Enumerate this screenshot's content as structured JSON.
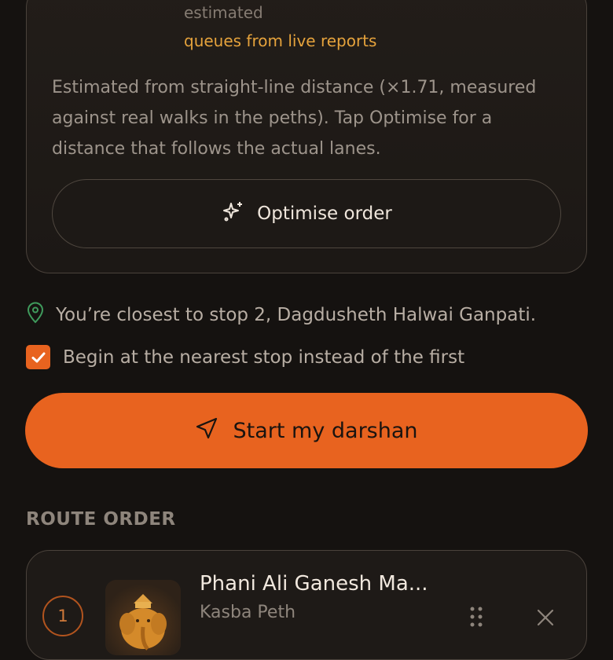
{
  "summary_card": {
    "estimated_label": "estimated",
    "queues_label": "queues from live reports",
    "note": "Estimated from straight-line distance (×1.71, measured against real walks in the peths). Tap Optimise for a distance that follows the actual lanes.",
    "optimise_button": "Optimise order",
    "optimise_icon": "sparkles-icon"
  },
  "location": {
    "icon": "map-pin-icon",
    "text": "You’re closest to stop 2, Dagdusheth Halwai Ganpati."
  },
  "nearest_option": {
    "label": "Begin at the nearest stop instead of the first",
    "checked": true
  },
  "start_button": {
    "label": "Start my darshan",
    "icon": "navigation-arrow-icon"
  },
  "route": {
    "section_label": "ROUTE ORDER",
    "stops": [
      {
        "number": "1",
        "name": "Phani Ali Ganesh Ma...",
        "area": "Kasba Peth"
      }
    ]
  },
  "colors": {
    "accent": "#e8631f",
    "highlight": "#e6a33c",
    "background": "#151210",
    "location_icon": "#3f9a5c"
  }
}
